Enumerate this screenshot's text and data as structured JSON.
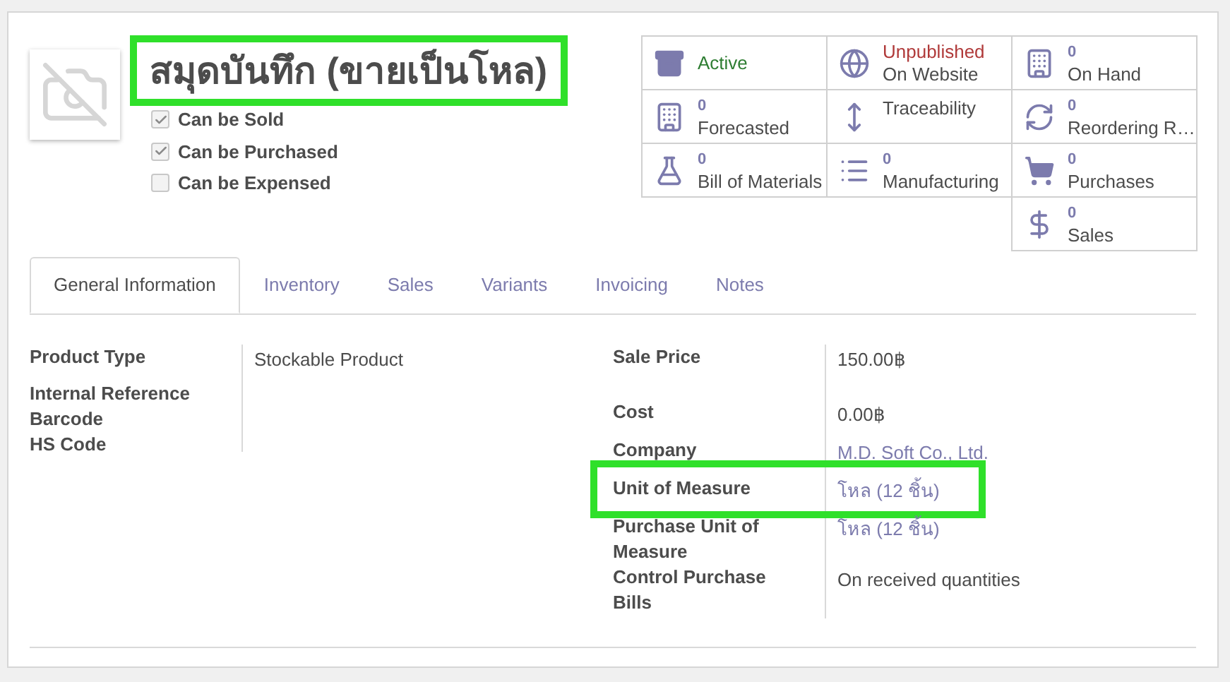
{
  "product": {
    "title": "สมุดบันทึก (ขายเป็นโหล)",
    "highlighted": true
  },
  "options": [
    {
      "label": "Can be Sold",
      "checked": true
    },
    {
      "label": "Can be Purchased",
      "checked": true
    },
    {
      "label": "Can be Expensed",
      "checked": false
    }
  ],
  "stat_buttons": [
    {
      "kind": "status",
      "label": "Active",
      "color": "#2e7d32"
    },
    {
      "kind": "status",
      "value": "Unpublished",
      "label": "On Website",
      "color": "#b03a3a"
    },
    {
      "kind": "count",
      "value": "0",
      "label": "On Hand"
    },
    {
      "kind": "count",
      "value": "0",
      "label": "Forecasted"
    },
    {
      "kind": "link",
      "label": "Traceability"
    },
    {
      "kind": "count",
      "value": "0",
      "label": "Reordering R…"
    },
    {
      "kind": "count",
      "value": "0",
      "label": "Bill of Materials"
    },
    {
      "kind": "count",
      "value": "0",
      "label": "Manufacturing"
    },
    {
      "kind": "count",
      "value": "0",
      "label": "Purchases"
    },
    {
      "kind": "count",
      "value": "0",
      "label": "Sales"
    }
  ],
  "tabs": [
    {
      "label": "General Information",
      "selected": true
    },
    {
      "label": "Inventory",
      "selected": false
    },
    {
      "label": "Sales",
      "selected": false
    },
    {
      "label": "Variants",
      "selected": false
    },
    {
      "label": "Invoicing",
      "selected": false
    },
    {
      "label": "Notes",
      "selected": false
    }
  ],
  "left_fields": [
    {
      "label": "Product Type",
      "value": "Stockable Product",
      "kind": "select"
    },
    {
      "label": "Internal Reference",
      "kind": "text"
    },
    {
      "label": "Barcode",
      "kind": "text"
    },
    {
      "label": "HS Code",
      "kind": "text"
    }
  ],
  "right_fields": [
    {
      "label": "Sale Price",
      "value": "150.00฿",
      "kind": "money",
      "highlighted": false
    },
    {
      "label": "Cost",
      "value": "0.00฿",
      "kind": "text",
      "highlighted": false
    },
    {
      "label": "Company",
      "value": "M.D. Soft Co., Ltd.",
      "kind": "link",
      "highlighted": false
    },
    {
      "label": "Unit of Measure",
      "value": "โหล (12 ชิ้น)",
      "kind": "link",
      "highlighted": true
    },
    {
      "label": "Purchase Unit of Measure",
      "value": "โหล (12 ชิ้น)",
      "kind": "link",
      "highlighted": false
    },
    {
      "label": "Control Purchase Bills",
      "value": "On received quantities",
      "kind": "text",
      "highlighted": false
    }
  ]
}
